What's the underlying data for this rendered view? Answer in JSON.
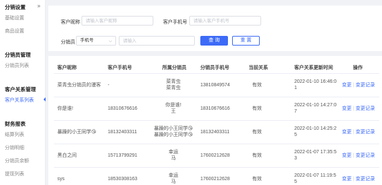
{
  "sidebar": {
    "collapse_glyph": "»",
    "groups": [
      {
        "title": "分销设置",
        "items": [
          "基础设置",
          "商品设置"
        ]
      },
      {
        "title": "分销员管理",
        "items": [
          "分销员列表"
        ]
      },
      {
        "title": "客户关系管理",
        "items": [
          "客户关系列表"
        ]
      },
      {
        "title": "财务报表",
        "items": [
          "结算列表",
          "分销明细",
          "分销员余额",
          "提现列表"
        ]
      }
    ],
    "active_item": "客户关系列表"
  },
  "filters": {
    "nickname_label": "客户昵称",
    "nickname_placeholder": "请输入客户昵称",
    "phone_label": "客户手机号",
    "phone_placeholder": "请输入客户手机号",
    "distributor_label": "分销员",
    "distributor_select": "手机号",
    "distributor_placeholder": "请输入",
    "query_button": "查 询",
    "reset_button": "重 置"
  },
  "table": {
    "columns": [
      "客户昵称",
      "客户手机号",
      "所属分销员",
      "分销员手机号",
      "当前关系",
      "客户关系更新时间",
      "操作"
    ],
    "rows": [
      {
        "nickname": "菜青虫分销员的漫客",
        "phone": "-",
        "distributor_line1": "菜青虫",
        "distributor_line2": "菜青虫",
        "dist_phone": "13810849574",
        "relation": "有效",
        "time_line1": "2022-01-10 16:46:0",
        "time_line2": "1"
      },
      {
        "nickname": "你是谁!",
        "phone": "18310676616",
        "distributor_line1": "你是谁!",
        "distributor_line2": "王",
        "dist_phone": "18310676616",
        "relation": "有效",
        "time_line1": "2022-01-10 14:27:0",
        "time_line2": "7"
      },
      {
        "nickname": "暴躁的小王同学😘",
        "phone": "18132403311",
        "distributor_line1": "暴躁的小王同学😘",
        "distributor_line2": "暴躁的小王同学😘",
        "dist_phone": "18132403311",
        "relation": "有效",
        "time_line1": "2022-01-10 14:25:2",
        "time_line2": "5"
      },
      {
        "nickname": "黑白之间",
        "phone": "15713799291",
        "distributor_line1": "幸运",
        "distributor_line2": "马",
        "dist_phone": "17600212628",
        "relation": "有效",
        "time_line1": "2022-01-07 17:35:5",
        "time_line2": "3"
      },
      {
        "nickname": "sys",
        "phone": "18530308163",
        "distributor_line1": "幸运",
        "distributor_line2": "马",
        "dist_phone": "17600212628",
        "relation": "有效",
        "time_line1": "2022-01-07 11:19:5",
        "time_line2": "5"
      }
    ],
    "action_change": "变更",
    "action_separator": "|",
    "action_record": "变更记录"
  },
  "colors": {
    "accent": "#3d6bf7"
  }
}
